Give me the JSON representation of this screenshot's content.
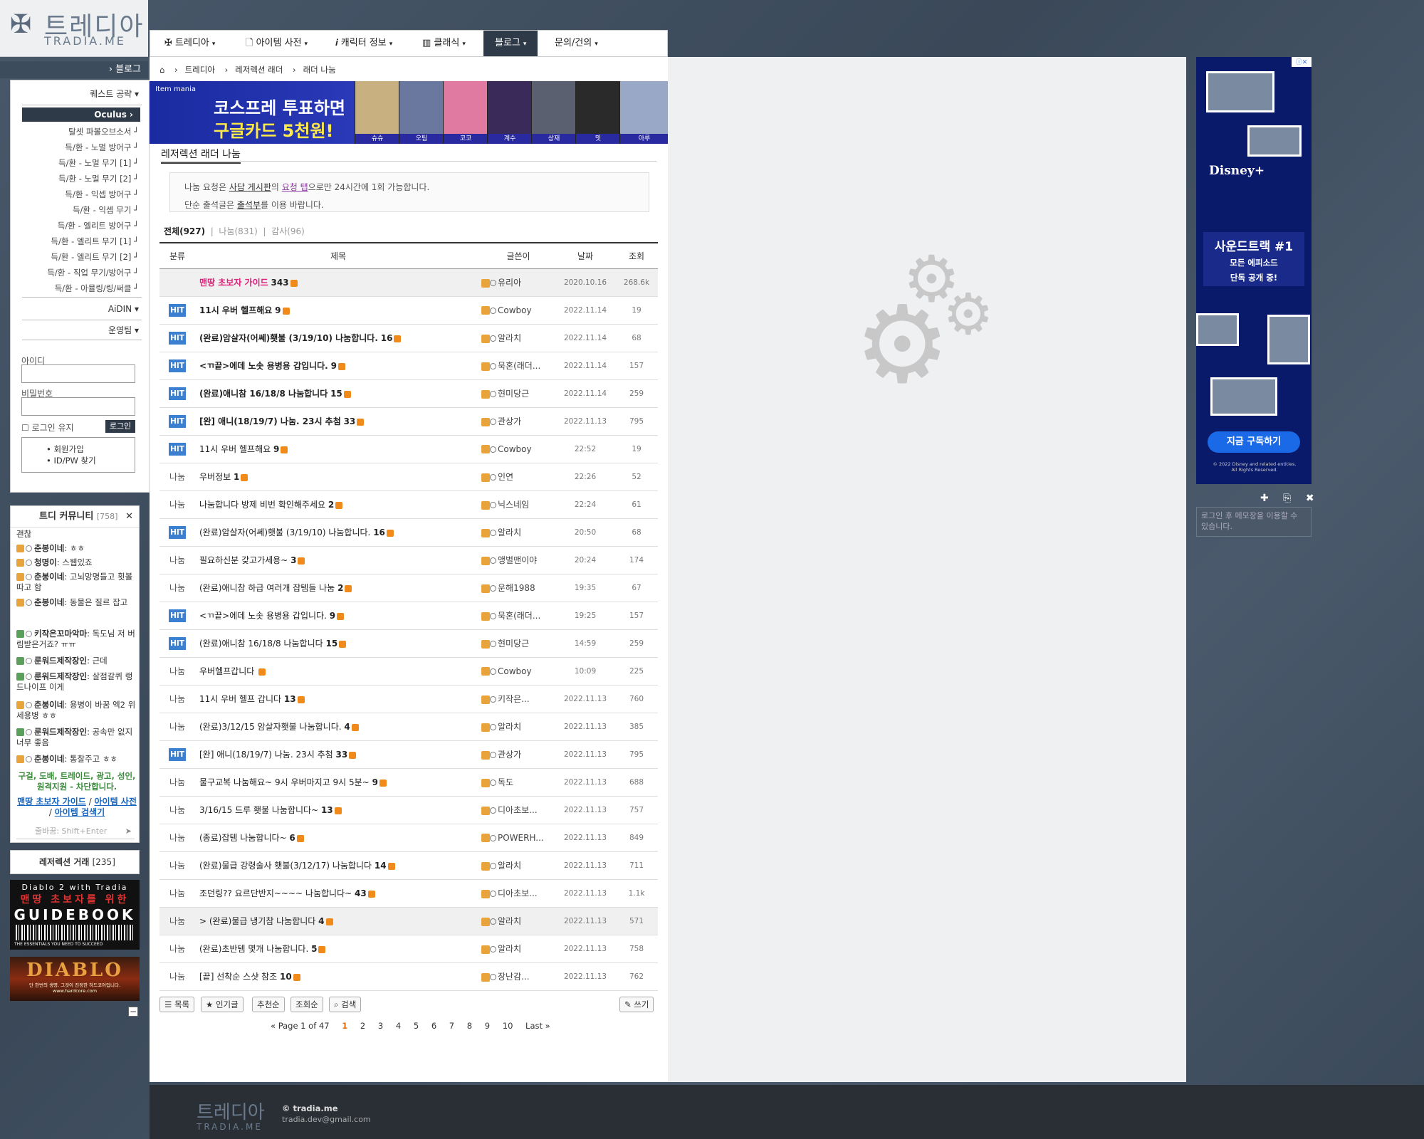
{
  "site": {
    "logo_kr": "트레디아",
    "logo_en": "TRADIA.ME"
  },
  "sidebar": {
    "header": "블로그",
    "items": [
      {
        "label": "퀘스트 공략 ▾",
        "type": "top"
      },
      {
        "label": "Oculus ›",
        "type": "sel"
      },
      {
        "label": "탈셋 파볼오브소서 ┘",
        "type": "sub"
      },
      {
        "label": "득/환 - 노멀 방어구 ┘",
        "type": "sub"
      },
      {
        "label": "득/환 - 노멀 무기 [1] ┘",
        "type": "sub"
      },
      {
        "label": "득/환 - 노멀 무기 [2] ┘",
        "type": "sub"
      },
      {
        "label": "득/환 - 익셉 방어구 ┘",
        "type": "sub"
      },
      {
        "label": "득/환 - 익셉 무기 ┘",
        "type": "sub"
      },
      {
        "label": "득/환 - 엘리트 방어구 ┘",
        "type": "sub"
      },
      {
        "label": "득/환 - 엘리트 무기 [1] ┘",
        "type": "sub"
      },
      {
        "label": "득/환 - 엘리트 무기 [2] ┘",
        "type": "sub"
      },
      {
        "label": "득/환 - 직업 무기/방어구 ┘",
        "type": "sub"
      },
      {
        "label": "득/환 - 아뮬링/링/써클 ┘",
        "type": "sub"
      },
      {
        "label": "AiDIN ▾",
        "type": "top"
      },
      {
        "label": "운영팀 ▾",
        "type": "top"
      }
    ],
    "login": {
      "id_label": "아이디",
      "pw_label": "비밀번호",
      "remember": "로그인 유지",
      "button": "로그인",
      "links": [
        "회원가입",
        "ID/PW 찾기"
      ]
    }
  },
  "community": {
    "title": "트디 커뮤니티",
    "count": "[758]",
    "messages": [
      {
        "user": "",
        "text": "괜찮"
      },
      {
        "user": "춘봉이네",
        "text": ": ㅎㅎ"
      },
      {
        "user": "청명이",
        "text": ": 스웹있죠"
      },
      {
        "user": "춘봉이네",
        "text": ": 고뇌망명들고 횟볼따고 함"
      },
      {
        "user": "춘봉이네",
        "text": ": 동물은 질르 잡고"
      },
      {
        "user": "키작은꼬마악마",
        "text": ": 독도님 저 버림받은거죠? ㅠㅠ"
      },
      {
        "user": "룬워드제작장인",
        "text": ": 근데"
      },
      {
        "user": "룬워드제작장인",
        "text": ": 살점갈퀴 랭드나이프 이게"
      },
      {
        "user": "춘봉이네",
        "text": ": 용병이 바꿈 엑2 위세용병 ㅎㅎ"
      },
      {
        "user": "룬워드제작장인",
        "text": ": 공속만 없지 너무 좋음"
      },
      {
        "user": "춘봉이네",
        "text": ": 통찰주고 ㅎㅎ"
      }
    ],
    "notice": "구걸, 도배, 트레이드, 광고, 성인, 원격지원 - 차단합니다.",
    "link1": "맨땅 초보자 가이드",
    "link2": "아이템 사전",
    "link3": "아이템 검색기",
    "input_placeholder": "줄바꿈: Shift+Enter"
  },
  "trade": {
    "label": "레저렉션 거래",
    "count": "[235]"
  },
  "ads_left": {
    "g1": "Diablo 2  with  Tradia",
    "g2": "맨땅 초보자를 위한",
    "g3": "GUIDEBOOK",
    "g4": "THE ESSENTIALS YOU NEED TO SUCCEED",
    "d1": "DIABLO",
    "d2": "단 한번의 생명, 그것이 진정한 하드코어입니다.",
    "d3": "www.hardcore.com"
  },
  "nav": {
    "items": [
      "트레디아",
      "아이템 사전",
      "캐릭터 정보",
      "클래식",
      "블로그",
      "문의/건의"
    ],
    "active": 4
  },
  "breadcrumb": [
    "트레디아",
    "레저렉션 래더",
    "래더 나눔"
  ],
  "banner": {
    "tag": "Item mania",
    "line1": "코스프레 투표하면",
    "line2": "구글카드 5천원!",
    "names": [
      "슈슈",
      "오팀",
      "코코",
      "계수",
      "상재",
      "밋",
      "아루"
    ]
  },
  "page": {
    "title": "레저렉션 래더 나눔",
    "info1_a": "나눔 요청은 ",
    "info1_b": "사담 게시판",
    "info1_c": "의 ",
    "info1_d": "요청 탭",
    "info1_e": "으로만 24시간에 1회 가능합니다.",
    "info2_a": "단순 출석글은 ",
    "info2_b": "출석부",
    "info2_c": "를 이용 바랍니다.",
    "tabs": [
      "전체(927)",
      "나눔(831)",
      "감사(96)"
    ]
  },
  "board": {
    "headers": [
      "분류",
      "제목",
      "글쓴이",
      "날짜",
      "조회"
    ],
    "rows": [
      {
        "cat": "",
        "title": "맨땅 초보자 가이드",
        "cnt": "343",
        "author": "유리아",
        "date": "2020.10.16",
        "views": "268.6k",
        "style": "notice"
      },
      {
        "cat": "HIT",
        "title": "11시 우버 헬프해요",
        "cnt": "9",
        "author": "Cowboy",
        "date": "2022.11.14",
        "views": "19",
        "style": "bold"
      },
      {
        "cat": "HIT",
        "title": "(완료)암살자(어쎄)횃불 (3/19/10) 나눔합니다.",
        "cnt": "16",
        "author": "알라치",
        "date": "2022.11.14",
        "views": "68",
        "style": "bold"
      },
      {
        "cat": "HIT",
        "title": "<ㄲ끝>에데 노솟 용병용 갑입니다.",
        "cnt": "9",
        "author": "묵혼(래더...",
        "date": "2022.11.14",
        "views": "157",
        "style": "bold"
      },
      {
        "cat": "HIT",
        "title": "(완료)애니참 16/18/8 나눔합니다",
        "cnt": "15",
        "author": "현미당근",
        "date": "2022.11.14",
        "views": "259",
        "style": "bold"
      },
      {
        "cat": "HIT",
        "title": "[완] 애니(18/19/7) 나눔. 23시 추첨",
        "cnt": "33",
        "author": "관상가",
        "date": "2022.11.13",
        "views": "795",
        "style": "bold"
      },
      {
        "cat": "HIT",
        "title": "11시 우버 헬프해요",
        "cnt": "9",
        "author": "Cowboy",
        "date": "22:52",
        "views": "19",
        "style": ""
      },
      {
        "cat": "나눔",
        "title": "우버정보",
        "cnt": "1",
        "author": "인연",
        "date": "22:26",
        "views": "52",
        "style": ""
      },
      {
        "cat": "나눔",
        "title": "나눔합니다 방제 비번 확인해주세요",
        "cnt": "2",
        "author": "닉스네임",
        "date": "22:24",
        "views": "61",
        "style": ""
      },
      {
        "cat": "HIT",
        "title": "(완료)암살자(어쎄)횃불 (3/19/10) 나눔합니다.",
        "cnt": "16",
        "author": "알라치",
        "date": "20:50",
        "views": "68",
        "style": ""
      },
      {
        "cat": "나눔",
        "title": "필요하신분 갖고가세용~",
        "cnt": "3",
        "author": "앵벌맨이야",
        "date": "20:24",
        "views": "174",
        "style": ""
      },
      {
        "cat": "나눔",
        "title": "(완료)애니참 하급 여러개 잡템들 나눔",
        "cnt": "2",
        "author": "운해1988",
        "date": "19:35",
        "views": "67",
        "style": ""
      },
      {
        "cat": "HIT",
        "title": "<ㄲ끝>에데 노솟 용병용 갑입니다.",
        "cnt": "9",
        "author": "묵혼(래더...",
        "date": "19:25",
        "views": "157",
        "style": ""
      },
      {
        "cat": "HIT",
        "title": "(완료)애니참 16/18/8 나눔합니다",
        "cnt": "15",
        "author": "현미당근",
        "date": "14:59",
        "views": "259",
        "style": ""
      },
      {
        "cat": "나눔",
        "title": "우버헬프갑니다",
        "cnt": "",
        "author": "Cowboy",
        "date": "10:09",
        "views": "225",
        "style": ""
      },
      {
        "cat": "나눔",
        "title": "11시 우버 헬프 갑니다",
        "cnt": "13",
        "author": "키작은...",
        "date": "2022.11.13",
        "views": "760",
        "style": ""
      },
      {
        "cat": "나눔",
        "title": "(완료)3/12/15 암살자횃불 나눔합니다.",
        "cnt": "4",
        "author": "알라치",
        "date": "2022.11.13",
        "views": "385",
        "style": ""
      },
      {
        "cat": "HIT",
        "title": "[완] 애니(18/19/7) 나눔. 23시 추첨",
        "cnt": "33",
        "author": "관상가",
        "date": "2022.11.13",
        "views": "795",
        "style": ""
      },
      {
        "cat": "나눔",
        "title": "물구교복 나눔해요~ 9시 우버마지고 9시 5분~",
        "cnt": "9",
        "author": "독도",
        "date": "2022.11.13",
        "views": "688",
        "style": ""
      },
      {
        "cat": "나눔",
        "title": "3/16/15 드루 횃불 나눔합니다~",
        "cnt": "13",
        "author": "디아초보...",
        "date": "2022.11.13",
        "views": "757",
        "style": ""
      },
      {
        "cat": "나눔",
        "title": "(종료)잡템 나눔합니다~",
        "cnt": "6",
        "author": "POWERH...",
        "date": "2022.11.13",
        "views": "849",
        "style": ""
      },
      {
        "cat": "나눔",
        "title": "(완료)물급 강령술사 횃불(3/12/17) 나눔합니다",
        "cnt": "14",
        "author": "알라치",
        "date": "2022.11.13",
        "views": "711",
        "style": ""
      },
      {
        "cat": "나눔",
        "title": "조던링?? 요르단반지~~~~ 나눔합니다~",
        "cnt": "43",
        "author": "디아초보...",
        "date": "2022.11.13",
        "views": "1.1k",
        "style": ""
      },
      {
        "cat": "나눔",
        "title": "> (완료)물급 냉기참 나눔합니다",
        "cnt": "4",
        "author": "알라치",
        "date": "2022.11.13",
        "views": "571",
        "style": "current"
      },
      {
        "cat": "나눔",
        "title": "(완료)초반템 몇개 나눔합니다.",
        "cnt": "5",
        "author": "알라치",
        "date": "2022.11.13",
        "views": "758",
        "style": ""
      },
      {
        "cat": "나눔",
        "title": "[끝] 선착순 스샷 참조",
        "cnt": "10",
        "author": "장난감...",
        "date": "2022.11.13",
        "views": "762",
        "style": ""
      }
    ],
    "buttons": [
      "목록",
      "인기글",
      "추천순",
      "조회순",
      "검색"
    ],
    "write": "쓰기",
    "pager": {
      "first": "« Page 1 of 47",
      "pages": [
        "1",
        "2",
        "3",
        "4",
        "5",
        "6",
        "7",
        "8",
        "9",
        "10"
      ],
      "last": "Last »",
      "current": "1"
    }
  },
  "footer": {
    "logo_kr": "트레디아",
    "logo_en": "TRADIA.ME",
    "copy": "© tradia.me",
    "mail": "tradia.dev@gmail.com"
  },
  "ad_right": {
    "x": "ⓘ✕",
    "disney": "Disney+",
    "st1": "사운드트랙 #1",
    "st2": "모든 에피소드",
    "st3": "단독 공개 중!",
    "cta": "지금 구독하기",
    "copyright": "© 2022 Disney and related entities. All Rights Reserved."
  },
  "memo": {
    "placeholder": "로그인 후 메모장을 이용할 수 있습니다."
  }
}
